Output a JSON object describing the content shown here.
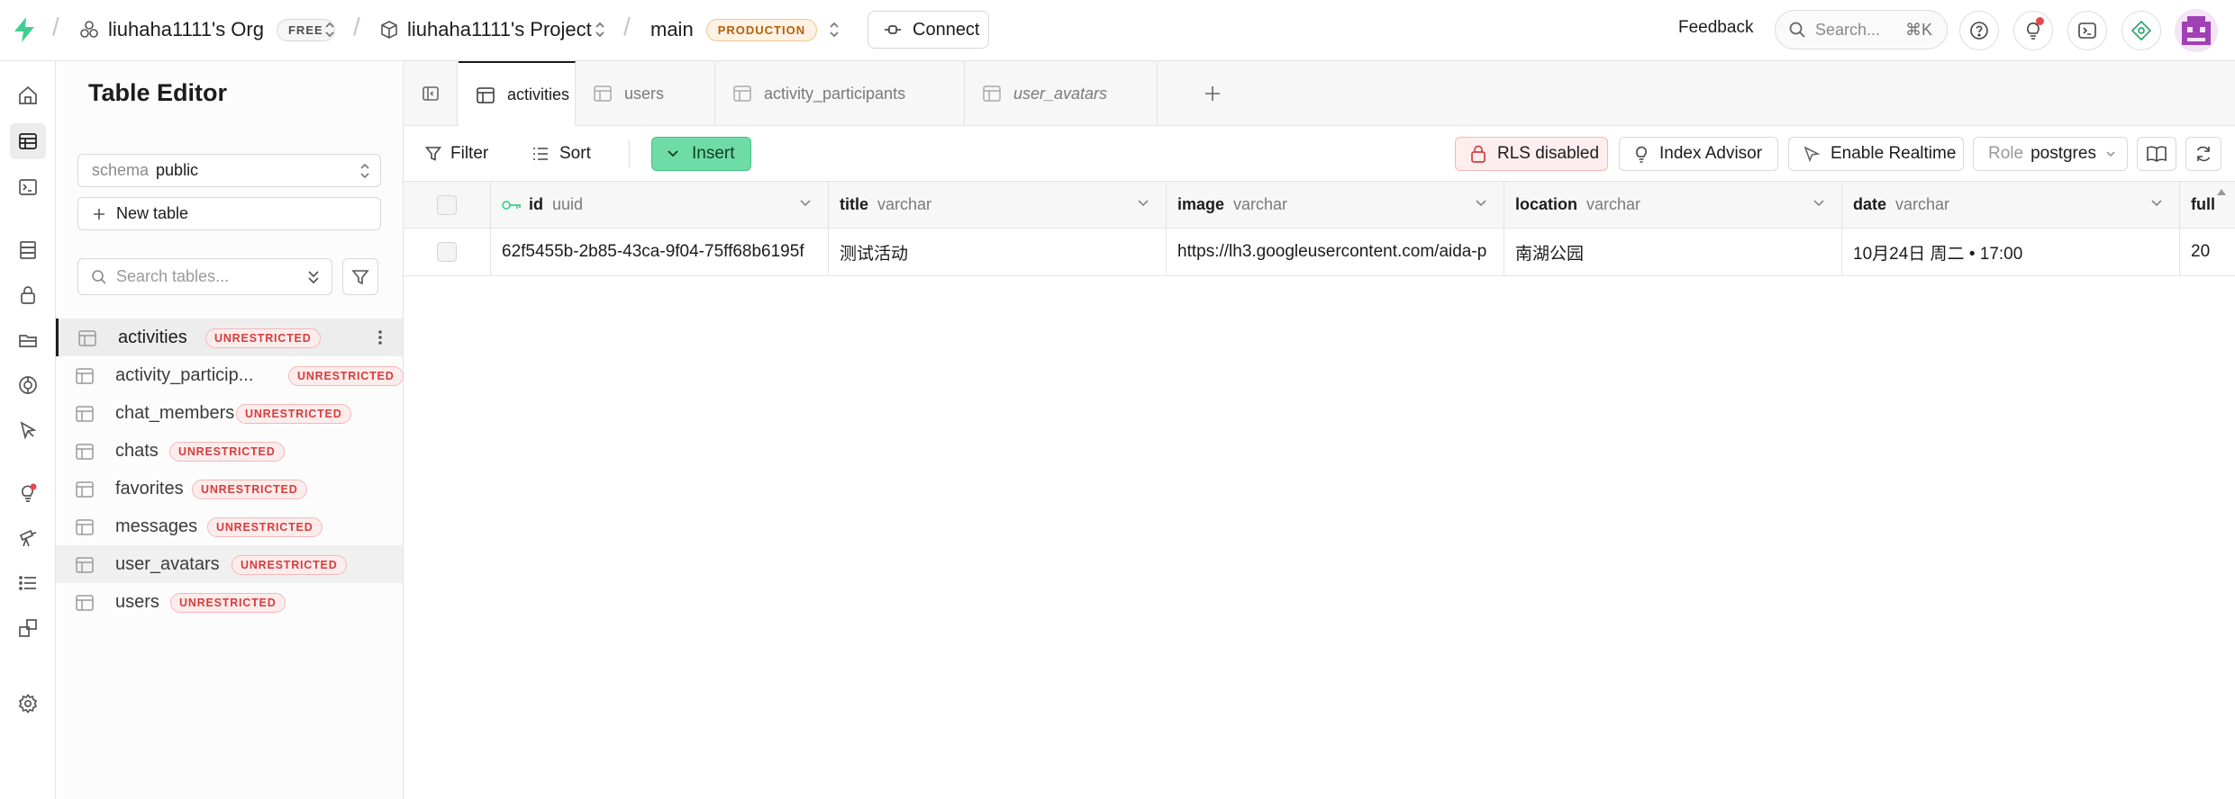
{
  "topbar": {
    "org_name": "liuhaha1111's Org",
    "org_plan": "FREE",
    "project_name": "liuhaha1111's Project",
    "branch": "main",
    "branch_badge": "PRODUCTION",
    "connect_label": "Connect",
    "feedback_label": "Feedback",
    "search_placeholder": "Search...",
    "search_shortcut": "⌘K"
  },
  "sidebar": {
    "title": "Table Editor",
    "schema_label": "schema",
    "schema_value": "public",
    "new_table_label": "New table",
    "search_placeholder": "Search tables...",
    "unrestricted_label": "UNRESTRICTED",
    "tables": [
      {
        "name": "activities"
      },
      {
        "name": "activity_particip..."
      },
      {
        "name": "chat_members"
      },
      {
        "name": "chats"
      },
      {
        "name": "favorites"
      },
      {
        "name": "messages"
      },
      {
        "name": "user_avatars"
      },
      {
        "name": "users"
      }
    ]
  },
  "tabs": [
    {
      "label": "activities"
    },
    {
      "label": "users"
    },
    {
      "label": "activity_participants"
    },
    {
      "label": "user_avatars"
    }
  ],
  "toolbar": {
    "filter_label": "Filter",
    "sort_label": "Sort",
    "insert_label": "Insert",
    "rls_label": "RLS disabled",
    "index_advisor_label": "Index Advisor",
    "realtime_label": "Enable Realtime",
    "role_label": "Role",
    "role_value": "postgres"
  },
  "grid": {
    "columns": [
      {
        "name": "id",
        "type": "uuid"
      },
      {
        "name": "title",
        "type": "varchar"
      },
      {
        "name": "image",
        "type": "varchar"
      },
      {
        "name": "location",
        "type": "varchar"
      },
      {
        "name": "date",
        "type": "varchar"
      },
      {
        "name": "full",
        "type": ""
      }
    ],
    "rows": [
      {
        "id": "62f5455b-2b85-43ca-9f04-75ff68b6195f",
        "title": "测试活动",
        "image": "https://lh3.googleusercontent.com/aida-p",
        "location": "南湖公园",
        "date": "10月24日 周二 • 17:00",
        "full": "20"
      }
    ]
  },
  "colors": {
    "brand_green": "#3ecf8e",
    "insert_bg": "#6fdca6",
    "unrestricted_red": "#d53d3d",
    "production_orange": "#b4610d"
  }
}
